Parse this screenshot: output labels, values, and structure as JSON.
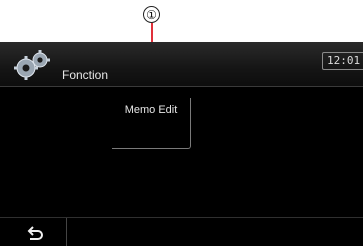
{
  "callout": {
    "number": "①"
  },
  "titlebar": {
    "title": "Fonction",
    "icon": "gear-icon"
  },
  "status": {
    "clock": "12:01"
  },
  "menu": {
    "items": [
      {
        "label": "Memo Edit"
      }
    ]
  },
  "bottombar": {
    "back_icon": "back-arrow-icon"
  },
  "colors": {
    "background": "#000000",
    "text": "#e6e6e6",
    "leader_line": "#e0303a"
  }
}
